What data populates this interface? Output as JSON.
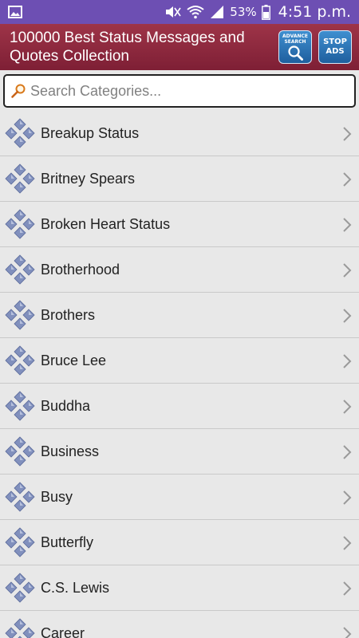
{
  "status_bar": {
    "battery": "53%",
    "time": "4:51 p.m."
  },
  "header": {
    "title": "100000 Best Status Messages and Quotes Collection",
    "advance_search_label_1": "ADVANCE",
    "advance_search_label_2": "SEARCH",
    "stop_ads_label_1": "STOP",
    "stop_ads_label_2": "ADS"
  },
  "search": {
    "placeholder": "Search Categories..."
  },
  "categories": [
    "Breakup Status",
    "Britney Spears",
    "Broken Heart Status",
    "Brotherhood",
    "Brothers",
    "Bruce Lee",
    "Buddha",
    "Business",
    "Busy",
    "Butterfly",
    "C.S. Lewis",
    "Career"
  ],
  "colors": {
    "status_bar": "#6d4fb3",
    "app_bar": "#8b2840",
    "diamond_icon": "#7e8db8",
    "list_background": "#e8e8e8"
  }
}
